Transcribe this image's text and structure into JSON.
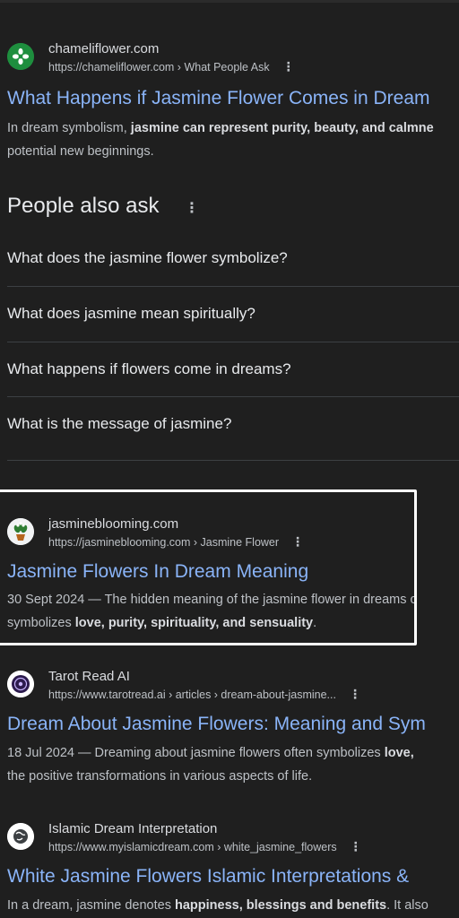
{
  "results": [
    {
      "site_name": "chameliflower.com",
      "url": "https://chameliflower.com › What People Ask",
      "title": "What Happens if Jasmine Flower Comes in Dream",
      "snippet_line1_pre": "In dream symbolism, ",
      "snippet_line1_bold": "jasmine can represent purity, beauty, and calmne",
      "snippet_line2": "potential new beginnings.",
      "favicon_color": "#1e8e3e",
      "favicon_icon": "flower-icon"
    },
    {
      "site_name": "jasmineblooming.com",
      "url": "https://jasmineblooming.com › Jasmine Flower",
      "title": "Jasmine Flowers In Dream Meaning",
      "snippet_line1": "30 Sept 2024 — The hidden meaning of the jasmine flower in dreams c",
      "snippet_line2_pre": "symbolizes ",
      "snippet_line2_bold": "love, purity, spirituality, and sensuality",
      "snippet_line2_post": ".",
      "favicon_icon": "potted-plant-icon"
    },
    {
      "site_name": "Tarot Read AI",
      "url": "https://www.tarotread.ai › articles › dream-about-jasmine...",
      "title": "Dream About Jasmine Flowers: Meaning and Sym",
      "snippet_line1_pre": "18 Jul 2024 — Dreaming about jasmine flowers often symbolizes ",
      "snippet_line1_bold": "love,",
      "snippet_line2": "the positive transformations in various aspects of life.",
      "favicon_icon": "tarot-icon"
    },
    {
      "site_name": "Islamic Dream Interpretation",
      "url": "https://www.myislamicdream.com › white_jasmine_flowers",
      "title": "White Jasmine Flowers Islamic Interpretations &",
      "snippet_line1_pre": "In a dream, jasmine denotes ",
      "snippet_line1_bold": "happiness, blessings and benefits",
      "snippet_line1_post": ". It also",
      "favicon_icon": "globe-icon"
    }
  ],
  "paa": {
    "heading": "People also ask",
    "questions": [
      "What does the jasmine flower symbolize?",
      "What does jasmine mean spiritually?",
      "What happens if flowers come in dreams?",
      "What is the message of jasmine?"
    ]
  },
  "kebab_glyph": "⋮",
  "colors": {
    "background": "#1f1f1f",
    "link": "#8ab4f8",
    "text": "#e8eaed",
    "muted": "#bdc1c6",
    "highlight": "#ffffff"
  }
}
